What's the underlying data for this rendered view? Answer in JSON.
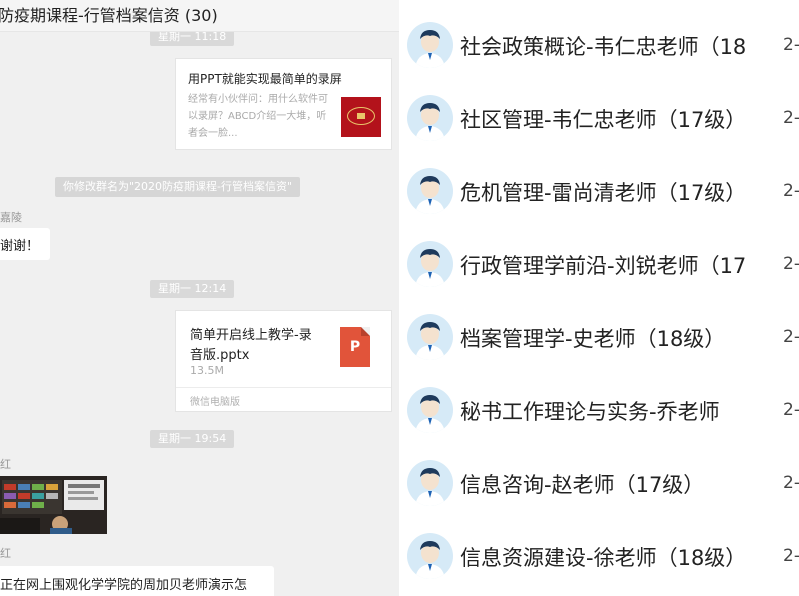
{
  "chat": {
    "title": "防疫期课程-行管档案信资 (30)",
    "top_time": "星期一 11:18",
    "link_card": {
      "title": "用PPT就能实现最简单的录屏",
      "desc": "经常有小伙伴问：用什么软件可以录屏？ABCD介绍一大堆，听者会一脸..."
    },
    "system_message": "你修改群名为\"2020防疫期课程-行管档案信资\"",
    "msg1_sender": "嘉陵",
    "msg1_text": "谢谢！",
    "time2": "星期一 12:14",
    "file_card": {
      "name_line1": "简单开启线上教学-录",
      "name_line2": "音版.pptx",
      "size": "13.5M",
      "source": "微信电脑版",
      "icon_letter": "P"
    },
    "time3": "星期一 19:54",
    "msg2_sender": "红",
    "msg3_sender": "红",
    "msg3_text": "正在网上围观化学学院的周加贝老师演示怎"
  },
  "courses": [
    {
      "title": "社会政策概论-韦仁忠老师（18",
      "date": "2-"
    },
    {
      "title": "社区管理-韦仁忠老师（17级）",
      "date": "2-"
    },
    {
      "title": "危机管理-雷尚清老师（17级）",
      "date": "2-"
    },
    {
      "title": "行政管理学前沿-刘锐老师（17",
      "date": "2-"
    },
    {
      "title": "档案管理学-史老师（18级）",
      "date": "2-"
    },
    {
      "title": "秘书工作理论与实务-乔老师",
      "date": "2-"
    },
    {
      "title": "信息咨询-赵老师（17级）",
      "date": "2-"
    },
    {
      "title": "信息资源建设-徐老师（18级）",
      "date": "2-"
    }
  ],
  "colors": {
    "chat_background": "#f0f0f0",
    "avatar_background": "#d6eaf7",
    "pptx_icon": "#e1543a",
    "link_thumb": "#b3121b"
  },
  "icons": {
    "avatar": "user-avatar-icon",
    "file": "pptx-file-icon"
  }
}
